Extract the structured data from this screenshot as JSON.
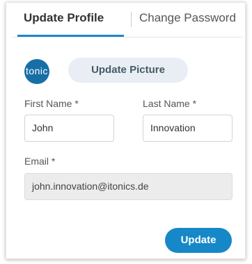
{
  "tabs": [
    {
      "label": "Update Profile",
      "active": true
    },
    {
      "label": "Change Password",
      "active": false
    }
  ],
  "avatar": {
    "text": "tonic",
    "color": "#176fa6"
  },
  "buttons": {
    "update_picture": "Update Picture",
    "update": "Update"
  },
  "form": {
    "first_name": {
      "label": "First Name *",
      "value": "John"
    },
    "last_name": {
      "label": "Last Name *",
      "value": "Innovation"
    },
    "email": {
      "label": "Email *",
      "value": "john.innovation@itonics.de",
      "disabled": true
    }
  },
  "colors": {
    "accent": "#1788c7",
    "picture_button_bg": "#e8eef3",
    "disabled_field_bg": "#ececec"
  }
}
